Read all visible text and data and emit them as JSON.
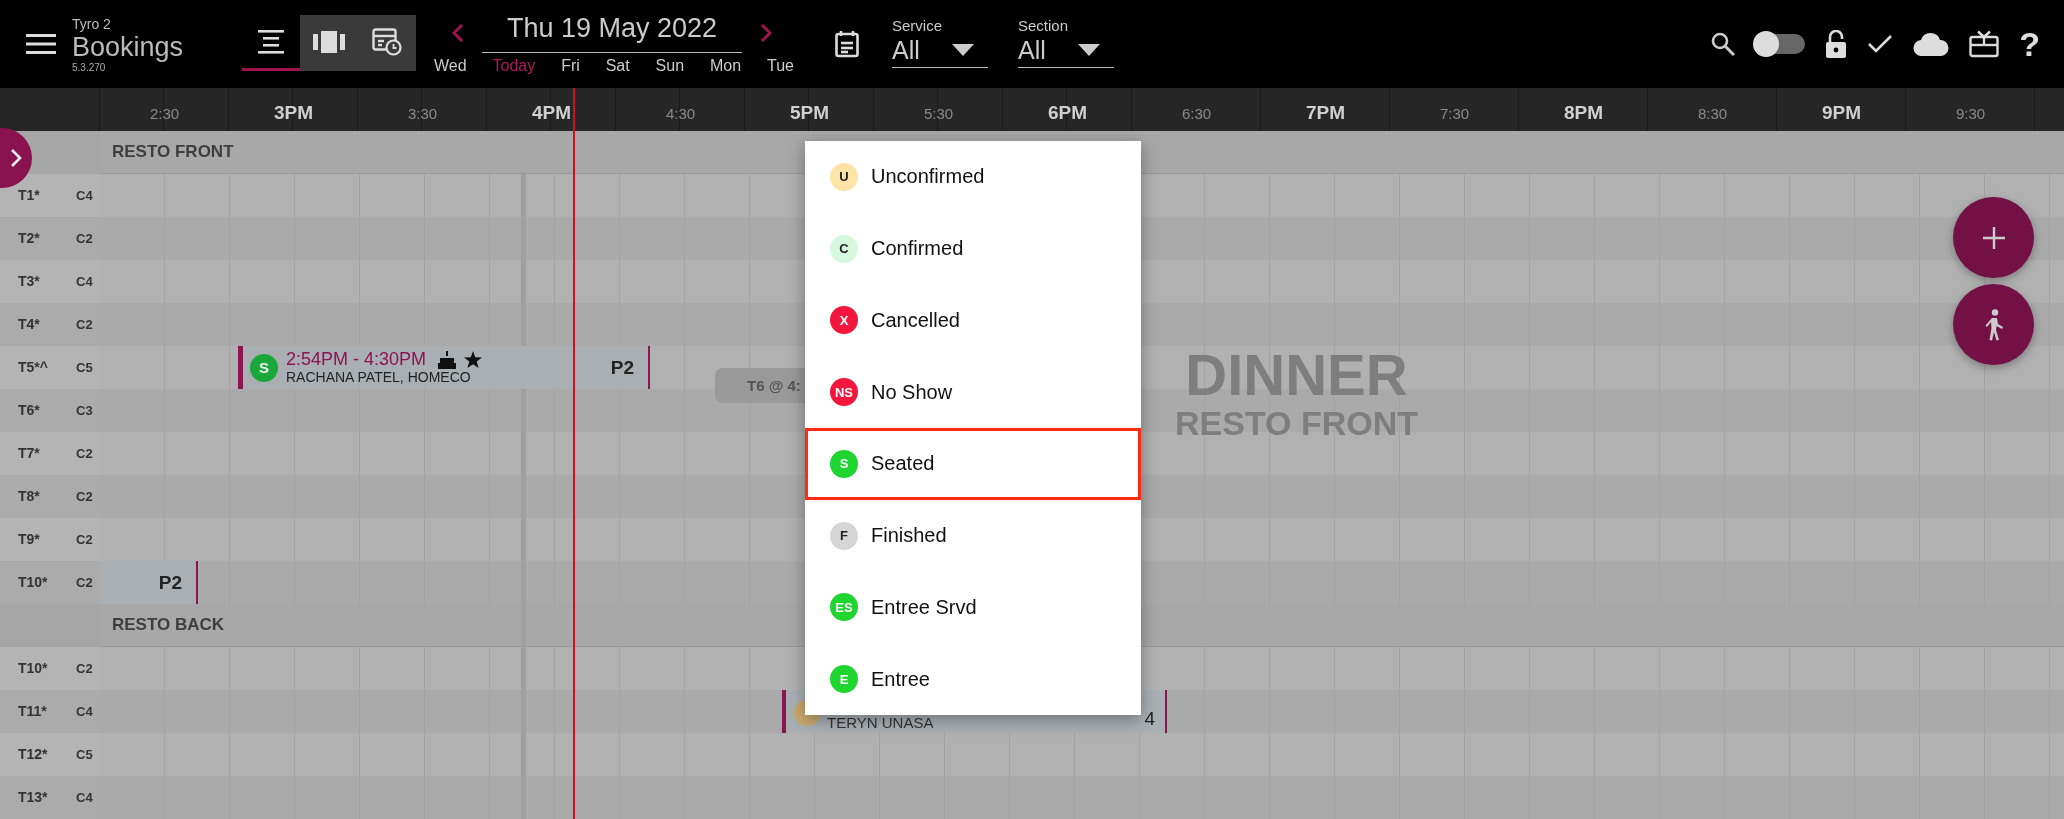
{
  "app": {
    "name": "Tyro 2",
    "title": "Bookings",
    "version": "5.3.270"
  },
  "view_tabs": [
    {
      "kind": "list",
      "selected": true
    },
    {
      "kind": "columns",
      "selected": false
    },
    {
      "kind": "schedule",
      "selected": false
    }
  ],
  "date": "Thu 19 May 2022",
  "days": [
    {
      "label": "Wed",
      "selected": false
    },
    {
      "label": "Today",
      "selected": true
    },
    {
      "label": "Fri",
      "selected": false
    },
    {
      "label": "Sat",
      "selected": false
    },
    {
      "label": "Sun",
      "selected": false
    },
    {
      "label": "Mon",
      "selected": false
    },
    {
      "label": "Tue",
      "selected": false
    }
  ],
  "filters": [
    {
      "label": "Service",
      "value": "All"
    },
    {
      "label": "Section",
      "value": "All"
    }
  ],
  "toolbar": {
    "toggle_on": false,
    "help": "?"
  },
  "timeline": [
    {
      "text": "2:30",
      "kind": "half"
    },
    {
      "text": "3PM",
      "kind": "hour"
    },
    {
      "text": "3:30",
      "kind": "half"
    },
    {
      "text": "4PM",
      "kind": "hour"
    },
    {
      "text": "4:30",
      "kind": "half"
    },
    {
      "text": "5PM",
      "kind": "hour"
    },
    {
      "text": "5:30",
      "kind": "half"
    },
    {
      "text": "6PM",
      "kind": "hour"
    },
    {
      "text": "6:30",
      "kind": "half"
    },
    {
      "text": "7PM",
      "kind": "hour"
    },
    {
      "text": "7:30",
      "kind": "half"
    },
    {
      "text": "8PM",
      "kind": "hour"
    },
    {
      "text": "8:30",
      "kind": "half"
    },
    {
      "text": "9PM",
      "kind": "hour"
    },
    {
      "text": "9:30",
      "kind": "half"
    }
  ],
  "sections": [
    {
      "name": "RESTO FRONT",
      "tables": [
        {
          "table": "T1*",
          "capacity": "C4"
        },
        {
          "table": "T2*",
          "capacity": "C2"
        },
        {
          "table": "T3*",
          "capacity": "C4"
        },
        {
          "table": "T4*",
          "capacity": "C2"
        },
        {
          "table": "T5*^",
          "capacity": "C5"
        },
        {
          "table": "T6*",
          "capacity": "C3"
        },
        {
          "table": "T7*",
          "capacity": "C2"
        },
        {
          "table": "T8*",
          "capacity": "C2"
        },
        {
          "table": "T9*",
          "capacity": "C2"
        },
        {
          "table": "T10*",
          "capacity": "C2"
        }
      ]
    },
    {
      "name": "RESTO BACK",
      "tables": [
        {
          "table": "T10*",
          "capacity": "C2"
        },
        {
          "table": "T11*",
          "capacity": "C4"
        },
        {
          "table": "T12*",
          "capacity": "C5"
        },
        {
          "table": "T13*",
          "capacity": "C4"
        }
      ]
    }
  ],
  "bookings": [
    {
      "kind": "full",
      "status": "S",
      "color": "#1aa83a",
      "time": "2:54PM - 4:30PM",
      "guest": "RACHANA PATEL, HOMECO",
      "party": "P2",
      "birthday": true,
      "vip": true
    },
    {
      "kind": "stub",
      "party": "P2"
    },
    {
      "kind": "chip",
      "label": "T6 @ 4:"
    },
    {
      "kind": "partial",
      "color": "#c9aa6e",
      "guest": "TERYN UNASA",
      "party": "4"
    }
  ],
  "service_label": {
    "title": "DINNER",
    "subtitle": "RESTO FRONT"
  },
  "status_menu": [
    {
      "code": "U",
      "label": "Unconfirmed",
      "color": "#fde4a6",
      "selected": false
    },
    {
      "code": "C",
      "label": "Confirmed",
      "color": "#d6f9de",
      "selected": false
    },
    {
      "code": "X",
      "label": "Cancelled",
      "color": "#f2173d",
      "selected": false
    },
    {
      "code": "NS",
      "label": "No Show",
      "color": "#f2173d",
      "selected": false
    },
    {
      "code": "S",
      "label": "Seated",
      "color": "#1fd52f",
      "selected": true
    },
    {
      "code": "F",
      "label": "Finished",
      "color": "#d6d6d6",
      "selected": false
    },
    {
      "code": "ES",
      "label": "Entree Srvd",
      "color": "#1fd52f",
      "selected": false
    },
    {
      "code": "E",
      "label": "Entree",
      "color": "#1fd52f",
      "selected": false
    }
  ]
}
